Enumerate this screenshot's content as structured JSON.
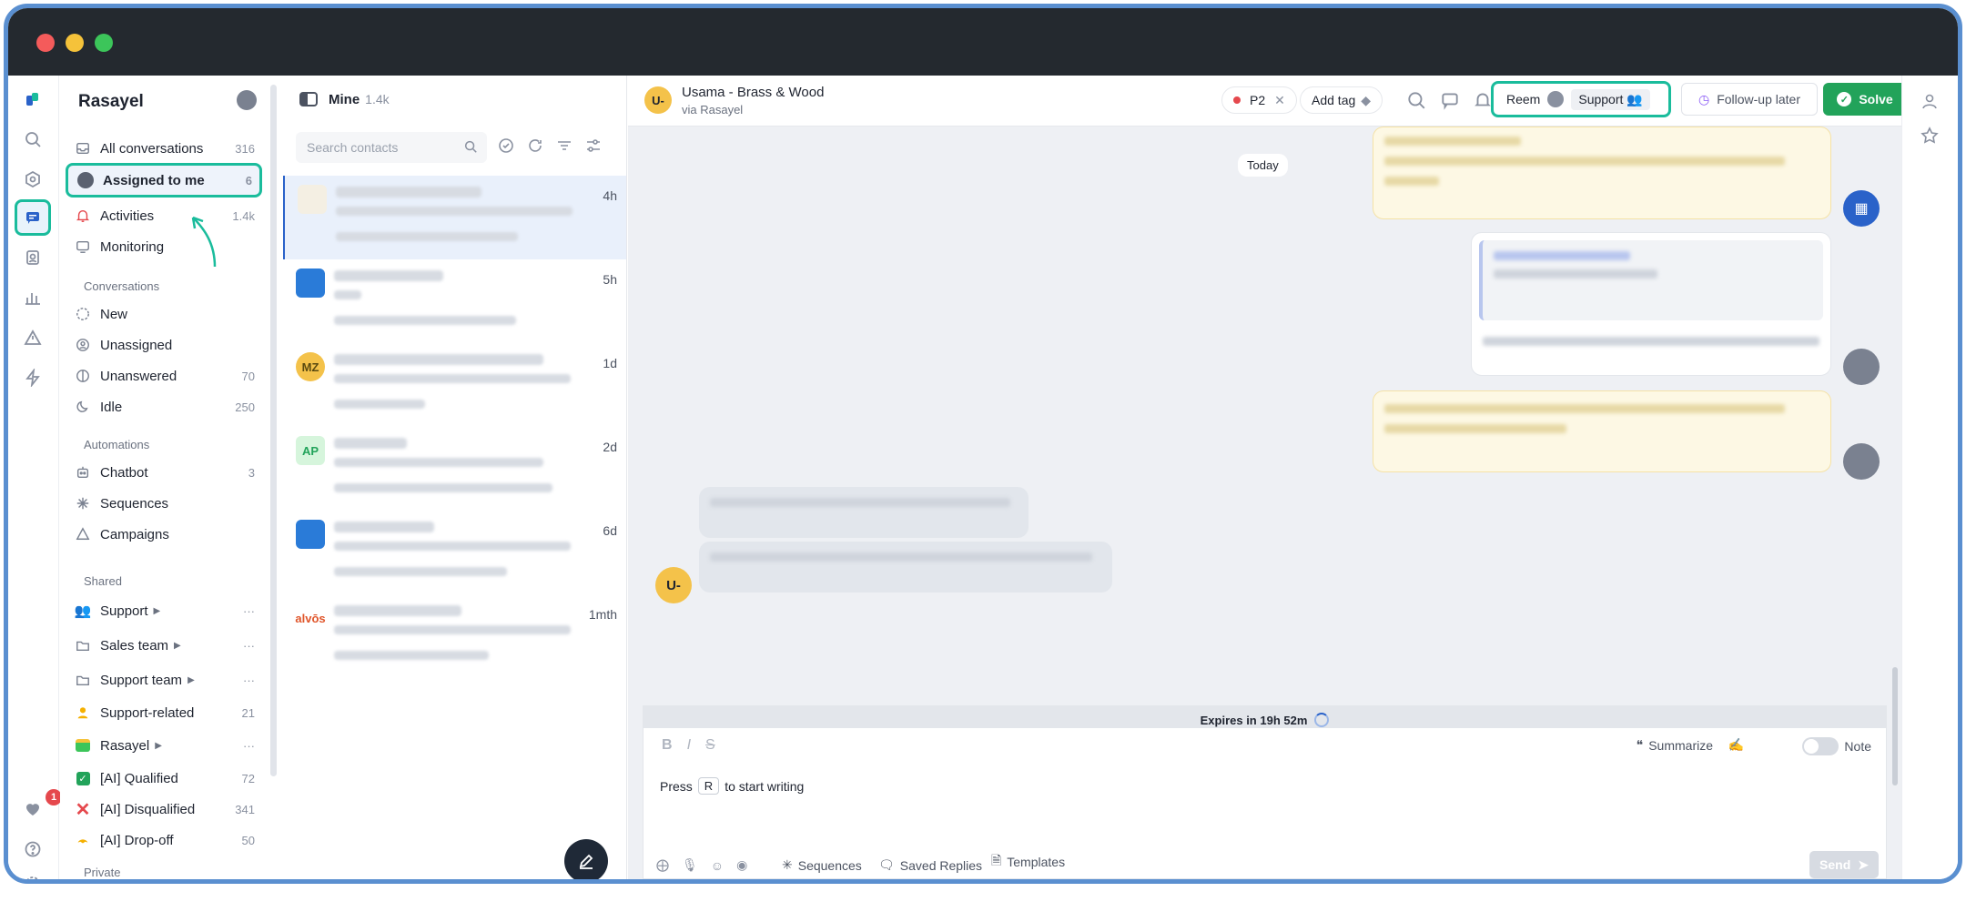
{
  "sidebar": {
    "title": "Rasayel",
    "items": [
      {
        "label": "All conversations",
        "count": "316"
      },
      {
        "label": "Assigned to me",
        "count": "6"
      },
      {
        "label": "Activities",
        "count": "1.4k"
      },
      {
        "label": "Monitoring",
        "count": ""
      }
    ],
    "conversations_header": "Conversations",
    "conversations": [
      {
        "label": "New",
        "count": ""
      },
      {
        "label": "Unassigned",
        "count": ""
      },
      {
        "label": "Unanswered",
        "count": "70"
      },
      {
        "label": "Idle",
        "count": "250"
      }
    ],
    "automations_header": "Automations",
    "automations": [
      {
        "label": "Chatbot",
        "count": "3"
      },
      {
        "label": "Sequences",
        "count": ""
      },
      {
        "label": "Campaigns",
        "count": ""
      }
    ],
    "shared_header": "Shared",
    "shared": [
      {
        "label": "Support",
        "count": ""
      },
      {
        "label": "Sales team",
        "count": ""
      },
      {
        "label": "Support team",
        "count": ""
      },
      {
        "label": "Support-related",
        "count": "21"
      },
      {
        "label": "Rasayel",
        "count": ""
      },
      {
        "label": "[AI] Qualified",
        "count": "72"
      },
      {
        "label": "[AI] Disqualified",
        "count": "341"
      },
      {
        "label": "[AI] Drop-off",
        "count": "50"
      }
    ],
    "private_header": "Private"
  },
  "rail": {
    "notification_count": "1"
  },
  "convlist": {
    "title": "Mine",
    "count": "1.4k",
    "search_placeholder": "Search contacts",
    "items": [
      {
        "initials": "",
        "time": "4h"
      },
      {
        "initials": "",
        "time": "5h"
      },
      {
        "initials": "MZ",
        "time": "1d"
      },
      {
        "initials": "AP",
        "time": "2d"
      },
      {
        "initials": "",
        "time": "6d"
      },
      {
        "initials": "alvōs",
        "time": "1mth"
      }
    ]
  },
  "main": {
    "contact_initials": "U-",
    "contact_name": "Usama - Brass & Wood",
    "contact_via": "via Rasayel",
    "priority": "P2",
    "add_tag": "Add tag",
    "assignee": "Reem",
    "team": "Support",
    "follow_up": "Follow-up later",
    "solve": "Solve",
    "today": "Today",
    "expires": "Expires in 19h 52m",
    "summarize": "Summarize",
    "note": "Note",
    "compose_press": "Press",
    "compose_key": "R",
    "compose_rest": "to start writing",
    "sequences": "Sequences",
    "saved_replies": "Saved Replies",
    "templates": "Templates",
    "send": "Send"
  },
  "colors": {
    "accent": "#1abc9c",
    "primary": "#2a62c9",
    "solve": "#22a35a"
  }
}
